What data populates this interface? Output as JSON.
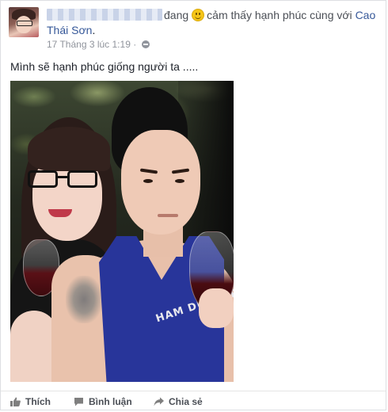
{
  "post": {
    "author_name_redacted": true,
    "status_verb": "đang",
    "feeling": "cảm thấy hạnh phúc cùng với",
    "tagged_name": "Cao Thái Sơn",
    "period": ".",
    "timestamp": "17 Tháng 3 lúc 1:19",
    "separator": " · ",
    "privacy_icon": "globe-icon",
    "text": "Mình sẽ hạnh phúc giống người ta .....",
    "photo_shirt_text": "HAM DUDIE RHNN"
  },
  "actions": {
    "like_label": "Thích",
    "comment_label": "Bình luận",
    "share_label": "Chia sẻ"
  },
  "colors": {
    "link": "#365899",
    "meta": "#90949c",
    "action": "#4b4f56"
  }
}
